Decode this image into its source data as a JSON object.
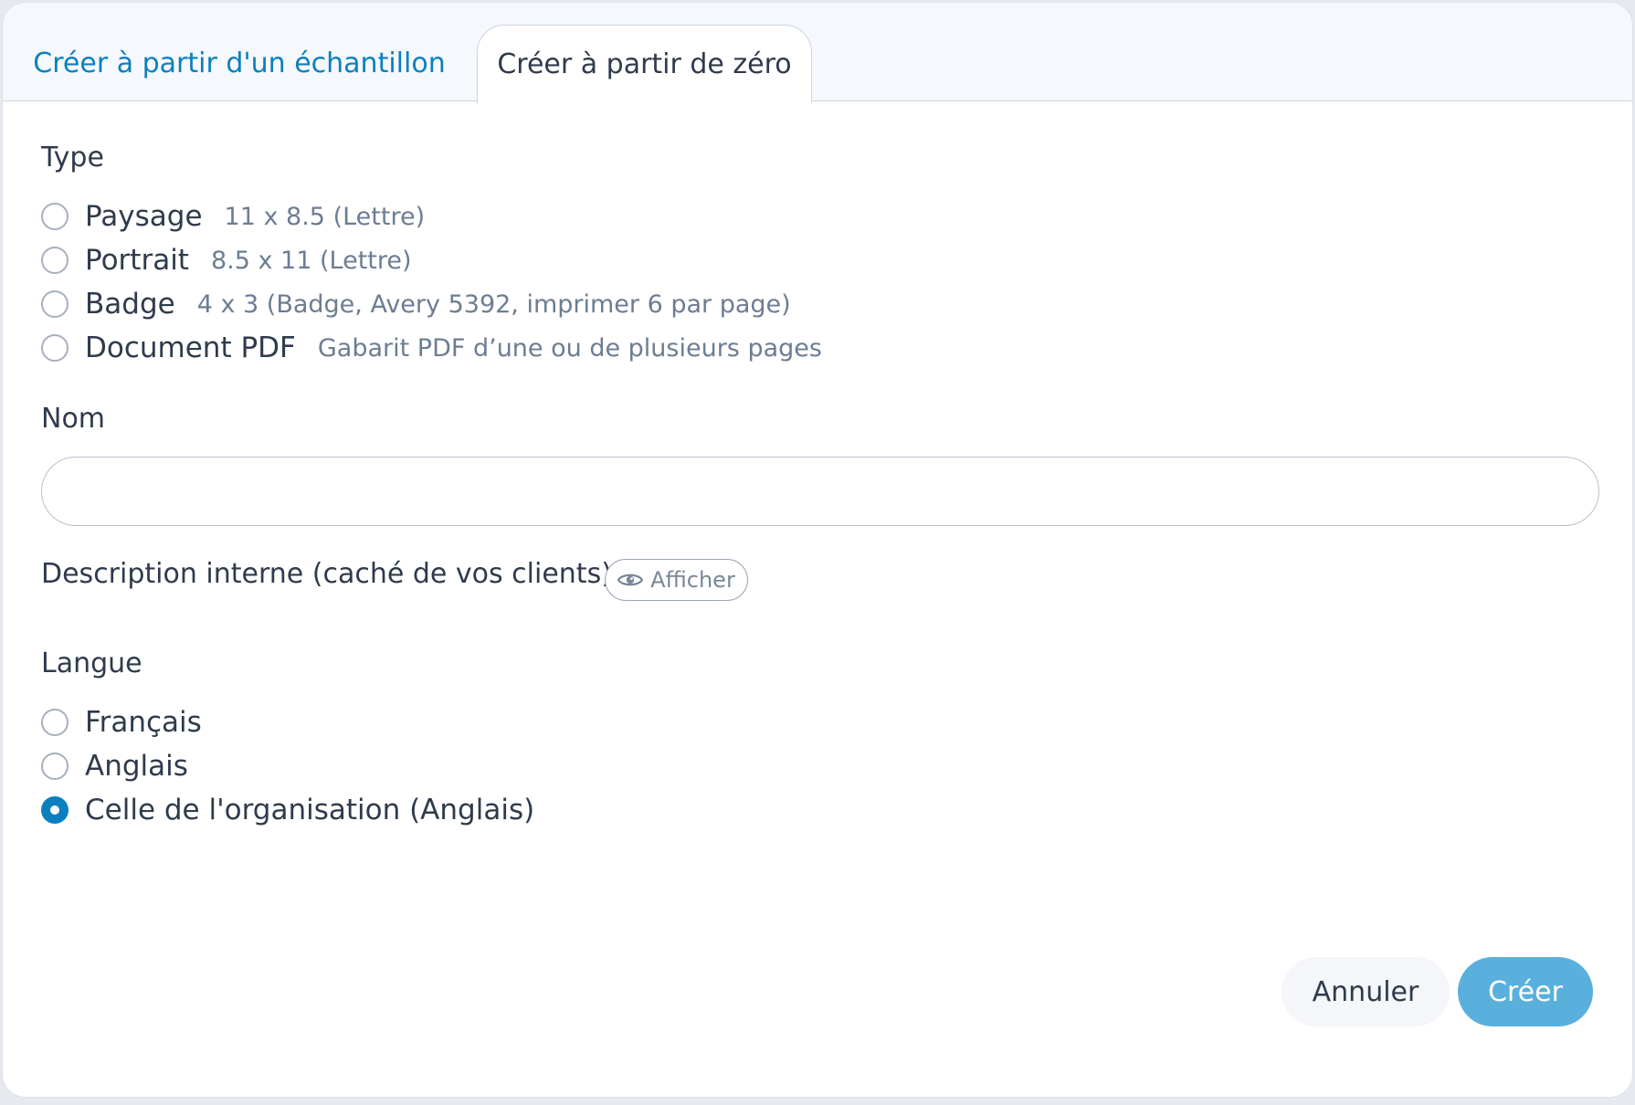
{
  "tabs": {
    "sample_label": "Créer à partir d'un échantillon",
    "zero_label": "Créer à partir de zéro"
  },
  "type_section": {
    "label": "Type",
    "options": [
      {
        "label": "Paysage",
        "hint": "11 x 8.5 (Lettre)",
        "checked": false
      },
      {
        "label": "Portrait",
        "hint": "8.5 x 11 (Lettre)",
        "checked": false
      },
      {
        "label": "Badge",
        "hint": "4 x 3 (Badge, Avery 5392, imprimer 6 par page)",
        "checked": false
      },
      {
        "label": "Document PDF",
        "hint": "Gabarit PDF d’une ou de plusieurs pages",
        "checked": false
      }
    ]
  },
  "name_section": {
    "label": "Nom",
    "value": "",
    "placeholder": ""
  },
  "description": {
    "label": "Description interne (caché de vos clients).",
    "show_button_label": "Afficher",
    "show_icon": "eye-icon"
  },
  "language_section": {
    "label": "Langue",
    "options": [
      {
        "label": "Français",
        "checked": false
      },
      {
        "label": "Anglais",
        "checked": false
      },
      {
        "label": "Celle de l'organisation (Anglais)",
        "checked": true
      }
    ]
  },
  "footer": {
    "cancel_label": "Annuler",
    "create_label": "Créer"
  },
  "colors": {
    "accent": "#0c7fbf",
    "primary_button": "#5ab0dc",
    "text": "#2f3b4c",
    "hint_text": "#6c7d93"
  }
}
